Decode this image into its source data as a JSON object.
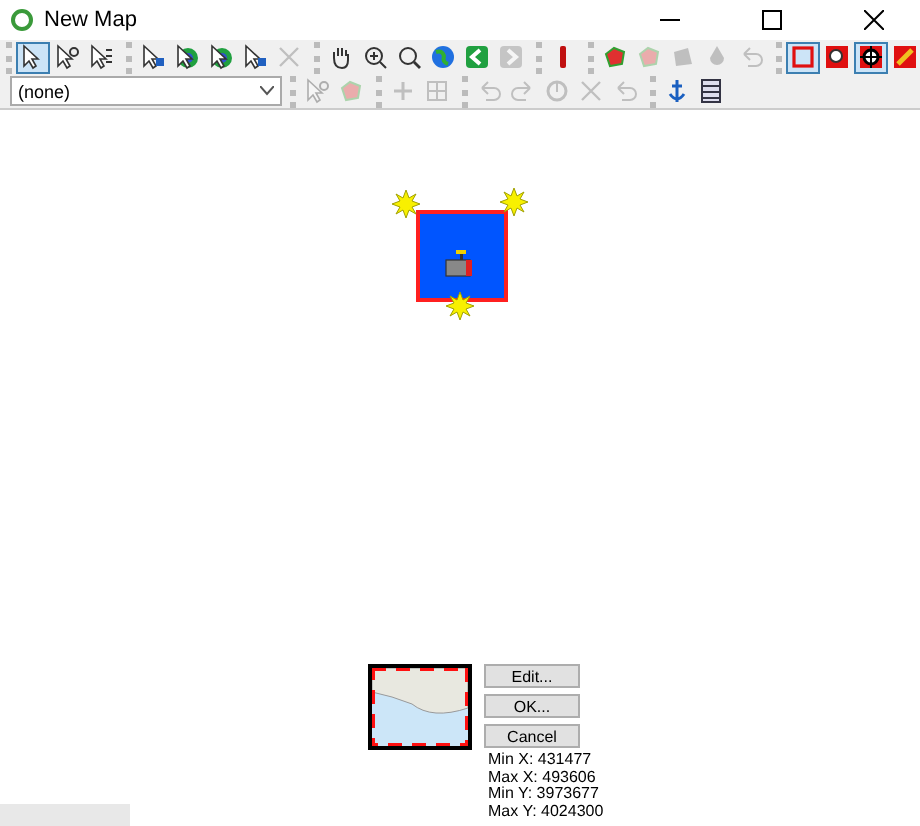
{
  "window": {
    "title": "New Map"
  },
  "toolbar_row_1": [
    [
      {
        "kind": "arrow",
        "selected": true,
        "disabled": false
      },
      {
        "kind": "arrow-plus",
        "selected": false,
        "disabled": false
      },
      {
        "kind": "arrow-list",
        "selected": false,
        "disabled": false
      }
    ],
    [
      {
        "kind": "arrow-node",
        "selected": false,
        "disabled": false
      },
      {
        "kind": "arrow-globe",
        "selected": false,
        "disabled": false
      },
      {
        "kind": "arrow-globe",
        "selected": false,
        "disabled": false
      },
      {
        "kind": "arrow-node",
        "selected": false,
        "disabled": false
      },
      {
        "kind": "x",
        "selected": false,
        "disabled": true
      }
    ],
    [
      {
        "kind": "hand",
        "selected": false,
        "disabled": false
      },
      {
        "kind": "zoom-plus",
        "selected": false,
        "disabled": false
      },
      {
        "kind": "zoom",
        "selected": false,
        "disabled": false
      },
      {
        "kind": "globe",
        "selected": false,
        "disabled": false
      },
      {
        "kind": "back",
        "selected": false,
        "disabled": false
      },
      {
        "kind": "forward",
        "selected": false,
        "disabled": true
      }
    ],
    [
      {
        "kind": "bar",
        "selected": false,
        "disabled": false
      }
    ],
    [
      {
        "kind": "blob",
        "selected": false,
        "disabled": false
      },
      {
        "kind": "blob",
        "selected": false,
        "disabled": true
      },
      {
        "kind": "shape",
        "selected": false,
        "disabled": true
      },
      {
        "kind": "drop",
        "selected": false,
        "disabled": true
      },
      {
        "kind": "undo",
        "selected": false,
        "disabled": true
      }
    ],
    [
      {
        "kind": "square",
        "selected": true,
        "disabled": false
      },
      {
        "kind": "zoom-box",
        "selected": false,
        "disabled": false
      },
      {
        "kind": "crosshair",
        "selected": true,
        "disabled": false
      },
      {
        "kind": "pencil",
        "selected": false,
        "disabled": false
      }
    ]
  ],
  "layer_select": {
    "value": "(none)"
  },
  "toolbar_row_2": [
    [
      {
        "kind": "arrow-plus",
        "selected": false,
        "disabled": true
      },
      {
        "kind": "blob",
        "selected": false,
        "disabled": true
      }
    ],
    [
      {
        "kind": "plus",
        "selected": false,
        "disabled": true
      },
      {
        "kind": "grid",
        "selected": false,
        "disabled": true
      }
    ],
    [
      {
        "kind": "undo",
        "selected": false,
        "disabled": true
      },
      {
        "kind": "redo",
        "selected": false,
        "disabled": true
      },
      {
        "kind": "rotate",
        "selected": false,
        "disabled": true
      },
      {
        "kind": "x",
        "selected": false,
        "disabled": true
      },
      {
        "kind": "undo",
        "selected": false,
        "disabled": true
      }
    ],
    [
      {
        "kind": "anchor",
        "selected": false,
        "disabled": false
      },
      {
        "kind": "table",
        "selected": false,
        "disabled": false
      }
    ]
  ],
  "extent_dialog": {
    "buttons": [
      "Edit...",
      "OK...",
      "Cancel"
    ],
    "info": [
      "Min X: 431477",
      "Max X: 493606",
      "Min Y: 3973677",
      "Max Y: 4024300"
    ]
  }
}
